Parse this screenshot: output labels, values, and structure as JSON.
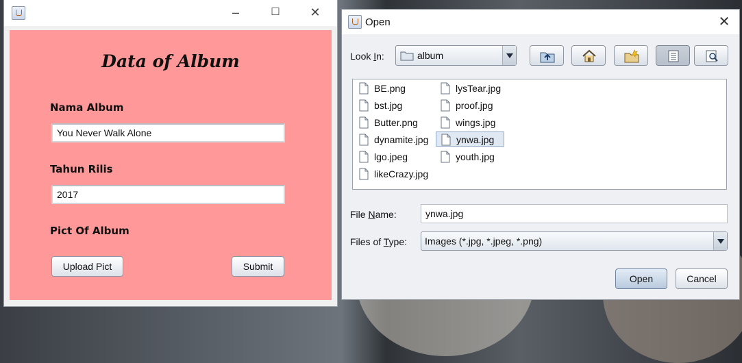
{
  "form_window": {
    "title": "Data of Album",
    "nama_album_label": "Nama Album",
    "nama_album_value": "You Never Walk Alone",
    "tahun_rilis_label": "Tahun Rilis",
    "tahun_rilis_value": "2017",
    "pict_label": "Pict Of Album",
    "upload_button": "Upload Pict",
    "submit_button": "Submit",
    "controls": {
      "minimize": "–",
      "maximize": "☐",
      "close": "✕"
    },
    "panel_color": "#ff9999"
  },
  "open_dialog": {
    "title": "Open",
    "close": "✕",
    "look_in_label_pre": "Look ",
    "look_in_label_u": "I",
    "look_in_label_post": "n:",
    "look_in_value": "album",
    "toolbar_icons": [
      "up-folder-icon",
      "home-icon",
      "new-folder-icon",
      "list-view-icon",
      "details-view-icon"
    ],
    "files_col1": [
      "BE.png",
      "bst.jpg",
      "Butter.png",
      "dynamite.jpg",
      "lgo.jpeg",
      "likeCrazy.jpg"
    ],
    "files_col2": [
      "lysTear.jpg",
      "proof.jpg",
      "wings.jpg",
      "ynwa.jpg",
      "youth.jpg"
    ],
    "selected_file": "ynwa.jpg",
    "file_name_label_pre": "File ",
    "file_name_label_u": "N",
    "file_name_label_post": "ame:",
    "file_name_value": "ynwa.jpg",
    "files_of_type_label_pre": "Files of ",
    "files_of_type_label_u": "T",
    "files_of_type_label_post": "ype:",
    "files_of_type_value": "Images (*.jpg, *.jpeg, *.png)",
    "open_button": "Open",
    "cancel_button": "Cancel"
  }
}
